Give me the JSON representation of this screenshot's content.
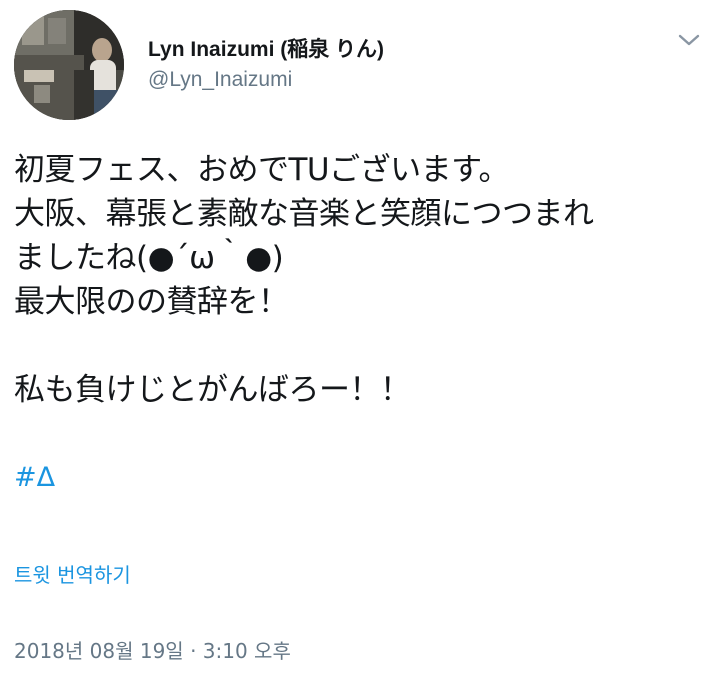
{
  "user": {
    "display_name": "Lyn Inaizumi (稲泉 りん)",
    "handle": "@Lyn_Inaizumi",
    "avatar_icon": "profile-photo"
  },
  "menu": {
    "icon": "chevron-down-icon"
  },
  "tweet": {
    "lines": [
      "初夏フェス、おめでTUございます。",
      "大阪、幕張と素敵な音楽と笑顔につつまれ",
      "ましたね(●´ω｀●)",
      "最大限のの賛辞を！",
      "",
      "私も負けじとがんばろー！！"
    ],
    "hashtag": "#Δ"
  },
  "actions": {
    "translate_label": "트윗 번역하기"
  },
  "meta": {
    "timestamp": "2018년 08월 19일 · 3:10 오후"
  },
  "colors": {
    "link": "#1b95e0",
    "secondary_text": "#657786",
    "primary_text": "#14171a"
  }
}
